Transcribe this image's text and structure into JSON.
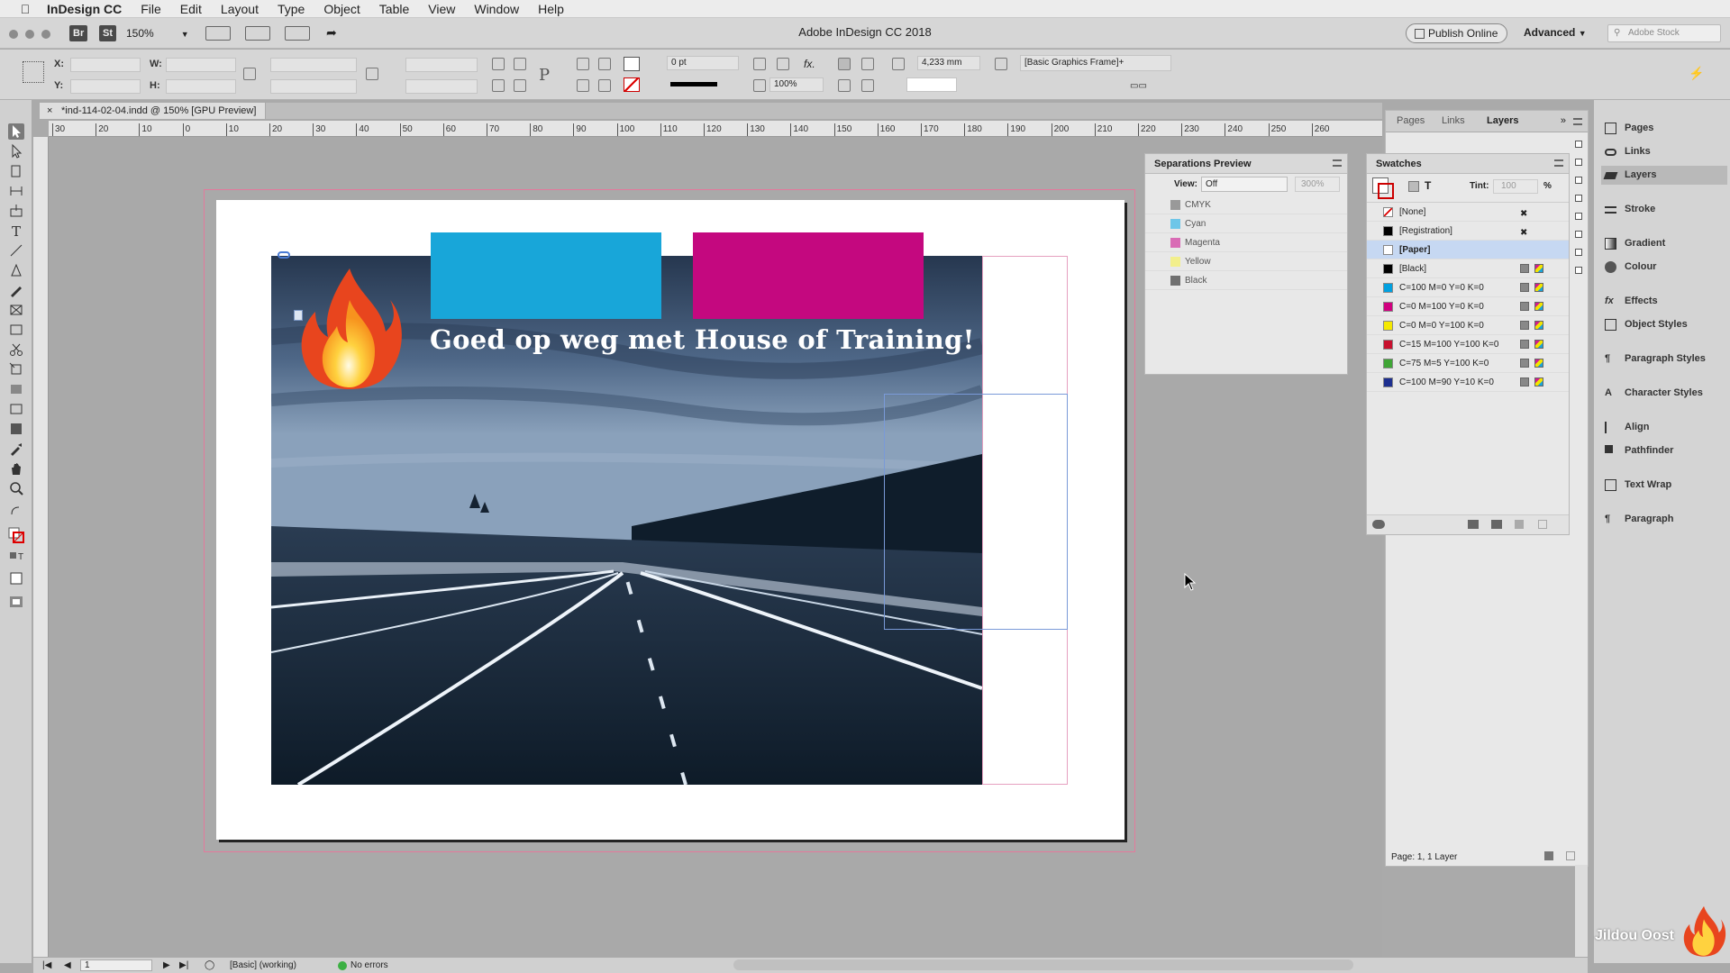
{
  "menubar": {
    "app": "InDesign CC",
    "items": [
      "File",
      "Edit",
      "Layout",
      "Type",
      "Object",
      "Table",
      "View",
      "Window",
      "Help"
    ]
  },
  "header": {
    "bridge": "Br",
    "stock": "St",
    "zoom": "150%",
    "title": "Adobe InDesign CC 2018",
    "publish": "Publish Online",
    "workspace": "Advanced",
    "search_placeholder": "Adobe Stock"
  },
  "control": {
    "x_label": "X:",
    "y_label": "Y:",
    "w_label": "W:",
    "h_label": "H:",
    "stroke_weight": "0 pt",
    "percent": "100%",
    "gap": "4,233 mm",
    "object_style": "[Basic Graphics Frame]+"
  },
  "document": {
    "tab": "*ind-114-02-04.indd @ 150% [GPU Preview]",
    "headline": "Goed op weg met House of Training!"
  },
  "ruler": {
    "ticks": [
      "30",
      "20",
      "10",
      "0",
      "10",
      "20",
      "30",
      "40",
      "50",
      "60",
      "70",
      "80",
      "90",
      "100",
      "110",
      "120",
      "130",
      "140",
      "150",
      "160",
      "170",
      "180",
      "190",
      "200",
      "210",
      "220",
      "230",
      "240",
      "250",
      "260"
    ]
  },
  "separations": {
    "title": "Separations Preview",
    "view_label": "View:",
    "view_value": "Off",
    "zoom_value": "300%",
    "inks": [
      {
        "name": "CMYK",
        "color": "#999999"
      },
      {
        "name": "Cyan",
        "color": "#6ec6e8"
      },
      {
        "name": "Magenta",
        "color": "#d96bb5"
      },
      {
        "name": "Yellow",
        "color": "#f2ef8c"
      },
      {
        "name": "Black",
        "color": "#707070"
      }
    ]
  },
  "swatches": {
    "title": "Swatches",
    "tint_label": "Tint:",
    "tint_value": "100",
    "tint_unit": "%",
    "items": [
      {
        "name": "[None]",
        "color": "#ffffff"
      },
      {
        "name": "[Registration]",
        "color": "#000000"
      },
      {
        "name": "[Paper]",
        "color": "#ffffff"
      },
      {
        "name": "[Black]",
        "color": "#000000"
      },
      {
        "name": "C=100 M=0 Y=0 K=0",
        "color": "#00a0e0"
      },
      {
        "name": "C=0 M=100 Y=0 K=0",
        "color": "#d0007f"
      },
      {
        "name": "C=0 M=0 Y=100 K=0",
        "color": "#f5e900"
      },
      {
        "name": "C=15 M=100 Y=100 K=0",
        "color": "#c8102e"
      },
      {
        "name": "C=75 M=5 Y=100 K=0",
        "color": "#3fa535"
      },
      {
        "name": "C=100 M=90 Y=10 K=0",
        "color": "#1d2f8f"
      }
    ]
  },
  "layers_panel": {
    "tabs": [
      "Pages",
      "Links",
      "Layers"
    ],
    "footer": "Page: 1, 1 Layer"
  },
  "dock": {
    "items": [
      "Pages",
      "Links",
      "Layers",
      "Stroke",
      "Gradient",
      "Colour",
      "Effects",
      "Object Styles",
      "Paragraph Styles",
      "Character Styles",
      "Align",
      "Pathfinder",
      "Text Wrap",
      "Paragraph"
    ]
  },
  "status": {
    "page": "1",
    "profile": "[Basic] (working)",
    "errors": "No errors"
  },
  "watermark": "Jildou Oost"
}
